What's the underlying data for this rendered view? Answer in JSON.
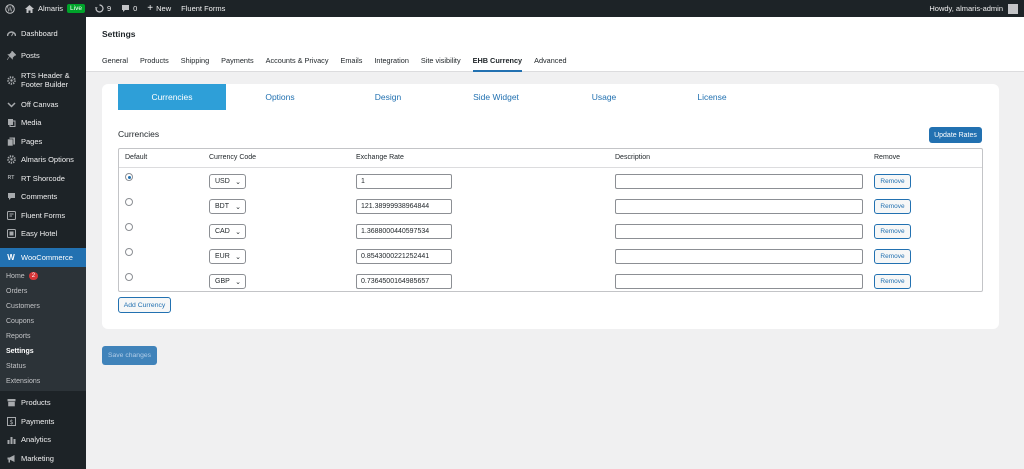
{
  "adminbar": {
    "site_name": "Almaris",
    "live_badge": "Live",
    "updates_count": "9",
    "comments_count": "0",
    "new_label": "New",
    "fluent_forms": "Fluent Forms",
    "howdy": "Howdy, almaris-admin"
  },
  "sidebar": {
    "items": [
      {
        "label": "Dashboard"
      },
      {
        "label": "Posts"
      },
      {
        "label": "RTS Header & Footer Builder"
      },
      {
        "label": "Off Canvas"
      },
      {
        "label": "Media"
      },
      {
        "label": "Pages"
      },
      {
        "label": "Almaris Options"
      },
      {
        "label": "RT Shorcode",
        "icon_text": "RT"
      },
      {
        "label": "Comments"
      },
      {
        "label": "Fluent Forms"
      },
      {
        "label": "Easy Hotel"
      },
      {
        "label": "WooCommerce"
      }
    ],
    "submenu": [
      {
        "label": "Home",
        "badge": "2"
      },
      {
        "label": "Orders"
      },
      {
        "label": "Customers"
      },
      {
        "label": "Coupons"
      },
      {
        "label": "Reports"
      },
      {
        "label": "Settings"
      },
      {
        "label": "Status"
      },
      {
        "label": "Extensions"
      }
    ],
    "after": [
      {
        "label": "Products"
      },
      {
        "label": "Payments"
      },
      {
        "label": "Analytics"
      },
      {
        "label": "Marketing"
      }
    ]
  },
  "header": {
    "title": "Settings",
    "tabs": [
      "General",
      "Products",
      "Shipping",
      "Payments",
      "Accounts & Privacy",
      "Emails",
      "Integration",
      "Site visibility",
      "EHB Currency",
      "Advanced"
    ],
    "active_tab": "EHB Currency"
  },
  "plugin": {
    "tabs": [
      "Currencies",
      "Options",
      "Design",
      "Side Widget",
      "Usage",
      "License"
    ],
    "active_tab": "Currencies",
    "section_title": "Currencies",
    "update_rates_label": "Update Rates",
    "columns": [
      "Default",
      "Currency Code",
      "Exchange Rate",
      "Description",
      "Remove"
    ],
    "rows": [
      {
        "code": "USD",
        "rate": "1",
        "description": "",
        "default": true
      },
      {
        "code": "BDT",
        "rate": "121.38999938964844",
        "description": "",
        "default": false
      },
      {
        "code": "CAD",
        "rate": "1.3688000440597534",
        "description": "",
        "default": false
      },
      {
        "code": "EUR",
        "rate": "0.8543000221252441",
        "description": "",
        "default": false
      },
      {
        "code": "GBP",
        "rate": "0.7364500164985657",
        "description": "",
        "default": false
      }
    ],
    "remove_label": "Remove",
    "add_currency_label": "Add Currency",
    "save_label": "Save changes"
  },
  "colors": {
    "admin_dark": "#1d2327",
    "accent": "#2271b1",
    "active_subtab": "#2e9fd8",
    "live": "#00a32a",
    "badge": "#d63638"
  }
}
